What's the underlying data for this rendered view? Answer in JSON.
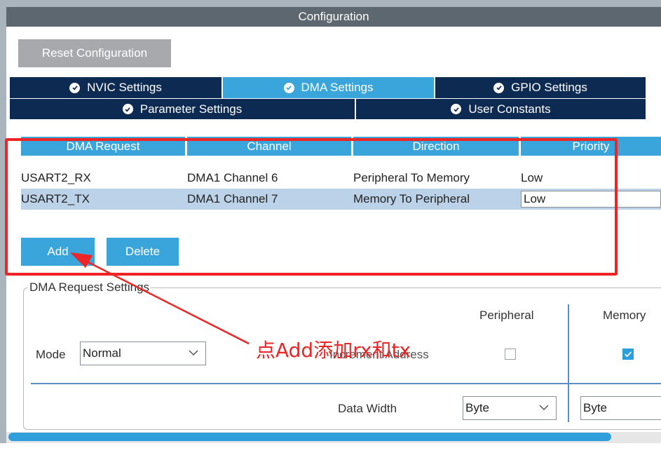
{
  "window": {
    "title": "Configuration"
  },
  "toolbar": {
    "reset_label": "Reset Configuration"
  },
  "tabs": {
    "row1": [
      {
        "label": "NVIC Settings",
        "active": false
      },
      {
        "label": "DMA Settings",
        "active": true
      },
      {
        "label": "GPIO Settings",
        "active": false
      }
    ],
    "row2": [
      {
        "label": "Parameter Settings",
        "active": false
      },
      {
        "label": "User Constants",
        "active": false
      }
    ]
  },
  "dma_table": {
    "headers": [
      "DMA Request",
      "Channel",
      "Direction",
      "Priority"
    ],
    "rows": [
      {
        "request": "USART2_RX",
        "channel": "DMA1 Channel 6",
        "direction": "Peripheral To Memory",
        "priority": "Low",
        "selected": false
      },
      {
        "request": "USART2_TX",
        "channel": "DMA1 Channel 7",
        "direction": "Memory To Peripheral",
        "priority": "Low",
        "selected": true
      }
    ]
  },
  "actions": {
    "add_label": "Add",
    "delete_label": "Delete"
  },
  "request_settings": {
    "legend": "DMA Request Settings",
    "peripheral_header": "Peripheral",
    "memory_header": "Memory",
    "mode_label": "Mode",
    "mode_value": "Normal",
    "increment_label": "Increment Address",
    "peripheral_increment": false,
    "memory_increment": true,
    "data_width_label": "Data Width",
    "peripheral_width": "Byte",
    "memory_width": "Byte"
  },
  "annotation": {
    "text": "点Add添加rx和tx",
    "color": "#ef2525"
  },
  "colors": {
    "accent": "#39a5db",
    "tab_dark": "#0d2b52",
    "title_bar": "#5d6770",
    "selection": "#bcd2e8"
  }
}
